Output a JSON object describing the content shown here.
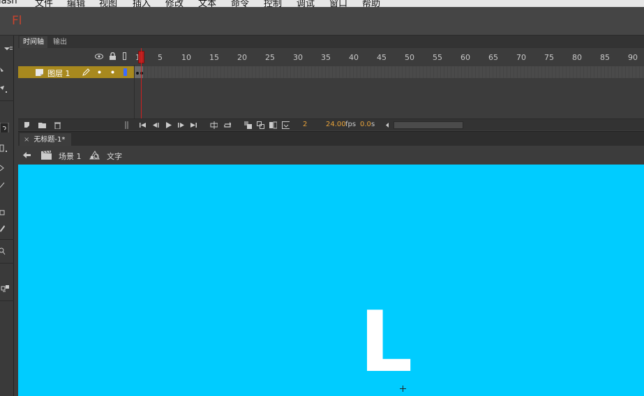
{
  "menubar": {
    "items": [
      "lash",
      "文件",
      "编辑",
      "视图",
      "插入",
      "修改",
      "文本",
      "命令",
      "控制",
      "调试",
      "窗口",
      "帮助"
    ]
  },
  "app": {
    "logo": "Fl"
  },
  "timeline": {
    "tabs": [
      {
        "label": "时间轴",
        "active": true
      },
      {
        "label": "输出",
        "active": false
      }
    ],
    "ruler": [
      "1",
      "5",
      "10",
      "15",
      "20",
      "25",
      "30",
      "35",
      "40",
      "45",
      "50",
      "55",
      "60",
      "65",
      "70",
      "75",
      "80",
      "85",
      "90"
    ],
    "layer": {
      "name": "图层 1"
    },
    "status": {
      "current_frame": "2",
      "fps": "24.00",
      "fps_unit": "fps",
      "time": "0.0",
      "time_unit": "s"
    }
  },
  "document": {
    "tab_label": "无标题-1*",
    "breadcrumb": {
      "scene": "场景 1",
      "symbol": "文字"
    }
  },
  "stage": {
    "background_color": "#00ccff",
    "text": "L"
  },
  "colors": {
    "accent_logo": "#c7442e",
    "layer_highlight": "#a8891e",
    "playhead": "#d0201f",
    "status_orange": "#e8a33a"
  }
}
